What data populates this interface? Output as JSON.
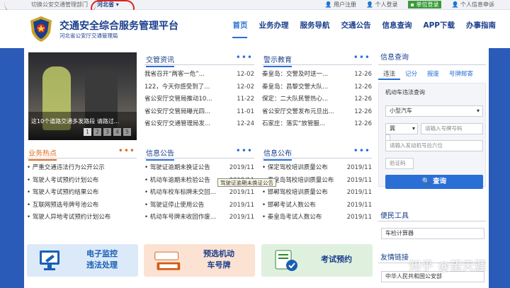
{
  "topbar": {
    "switch_label": "切换公安交通管理部门",
    "region": "河北省",
    "links": [
      "用户注册",
      "个人登录",
      "单位登录",
      "个人信息申诉"
    ]
  },
  "header": {
    "title": "交通安全综合服务管理平台",
    "subtitle": "河北省公安厅交通管理局",
    "nav": [
      "首页",
      "业务办理",
      "服务导航",
      "交通公告",
      "信息查询",
      "APP下载",
      "办事指南"
    ]
  },
  "photo": {
    "caption": "这10个道路交通多发路段 请路过...",
    "pages": [
      "1",
      "2",
      "3",
      "4",
      "5"
    ]
  },
  "news": {
    "title": "交管资讯",
    "items": [
      {
        "t": "我省召开“两客一危”...",
        "d": "12-02"
      },
      {
        "t": "122，今天你感受到了...",
        "d": "12-02"
      },
      {
        "t": "省公安厅交管局推动10...",
        "d": "11-22"
      },
      {
        "t": "省公安厅交管局曝光四...",
        "d": "11-01"
      },
      {
        "t": "省公安厅交通管理局发...",
        "d": "12-24"
      }
    ]
  },
  "warn": {
    "title": "警示教育",
    "items": [
      {
        "t": "秦皇岛：交警及时送一...",
        "d": "12-26"
      },
      {
        "t": "秦皇岛：昌黎交警大队...",
        "d": "12-26"
      },
      {
        "t": "保定：二大队民警热心...",
        "d": "12-26"
      },
      {
        "t": "省公安厅交警发布元旦出...",
        "d": "12-26"
      },
      {
        "t": "石家庄：落实“放管服...",
        "d": "12-26"
      }
    ]
  },
  "hot": {
    "title": "业务热点",
    "items": [
      "严重交通违法行为公开公示",
      "驾驶人考试预约计划公布",
      "驾驶人考试预约结果公布",
      "互联网预选号牌号池公布",
      "驾驶人异地考试预约计划公布"
    ]
  },
  "info": {
    "title": "信息公告",
    "items": [
      {
        "t": "驾驶证逾期未换证公告",
        "d": "2019/11"
      },
      {
        "t": "机动车逾期未检验公告",
        "d": "2019/11"
      },
      {
        "t": "机动车校车标牌未交回...",
        "d": "2019/11"
      },
      {
        "t": "驾驶证停止使用公告",
        "d": "2019/11"
      },
      {
        "t": "机动车号牌未收回作废...",
        "d": "2019/11"
      }
    ]
  },
  "pub": {
    "title": "信息公布",
    "items": [
      {
        "t": "保定驾校培训质量公布",
        "d": "2019/11"
      },
      {
        "t": "秦皇岛驾校培训质量公布",
        "d": "2019/11"
      },
      {
        "t": "邯郸驾校培训质量公布",
        "d": "2019/11"
      },
      {
        "t": "邯郸考试人数公布",
        "d": "2019/11"
      },
      {
        "t": "秦皇岛考试人数公布",
        "d": "2019/11"
      }
    ]
  },
  "tooltip": "驾驶证逾期未换证公告",
  "query": {
    "title": "信息查询",
    "tabs": [
      "违法",
      "记分",
      "报废",
      "号牌邮寄"
    ],
    "label": "机动车违法查询",
    "vehicle_type": "小型汽车",
    "province": "冀",
    "plate_placeholder": "请输入号牌号码",
    "engine_placeholder": "请输入发动机号后六位",
    "captcha_placeholder": "验证码",
    "button": "查询"
  },
  "tools": {
    "title": "便民工具",
    "item": "车检计算器"
  },
  "links": {
    "title": "友情链接",
    "item": "中华人民共和国公安部"
  },
  "tiles": [
    {
      "label1": "电子监控",
      "label2": "违法处理",
      "bg": "#dbe9f8",
      "color": "#1a5fb4"
    },
    {
      "label1": "预选机动",
      "label2": "车号牌",
      "bg": "#fbe2d2",
      "color": "#d45a10"
    },
    {
      "label1": "考试预约",
      "label2": "",
      "bg": "#dff1de",
      "color": "#2d8a2d"
    }
  ],
  "watermark": "知乎 @望天涯",
  "colors": {
    "brand": "#1a3e8c",
    "accent": "#2a6fd6",
    "band": "#2a5bb8",
    "hot": "#e06a1a"
  }
}
